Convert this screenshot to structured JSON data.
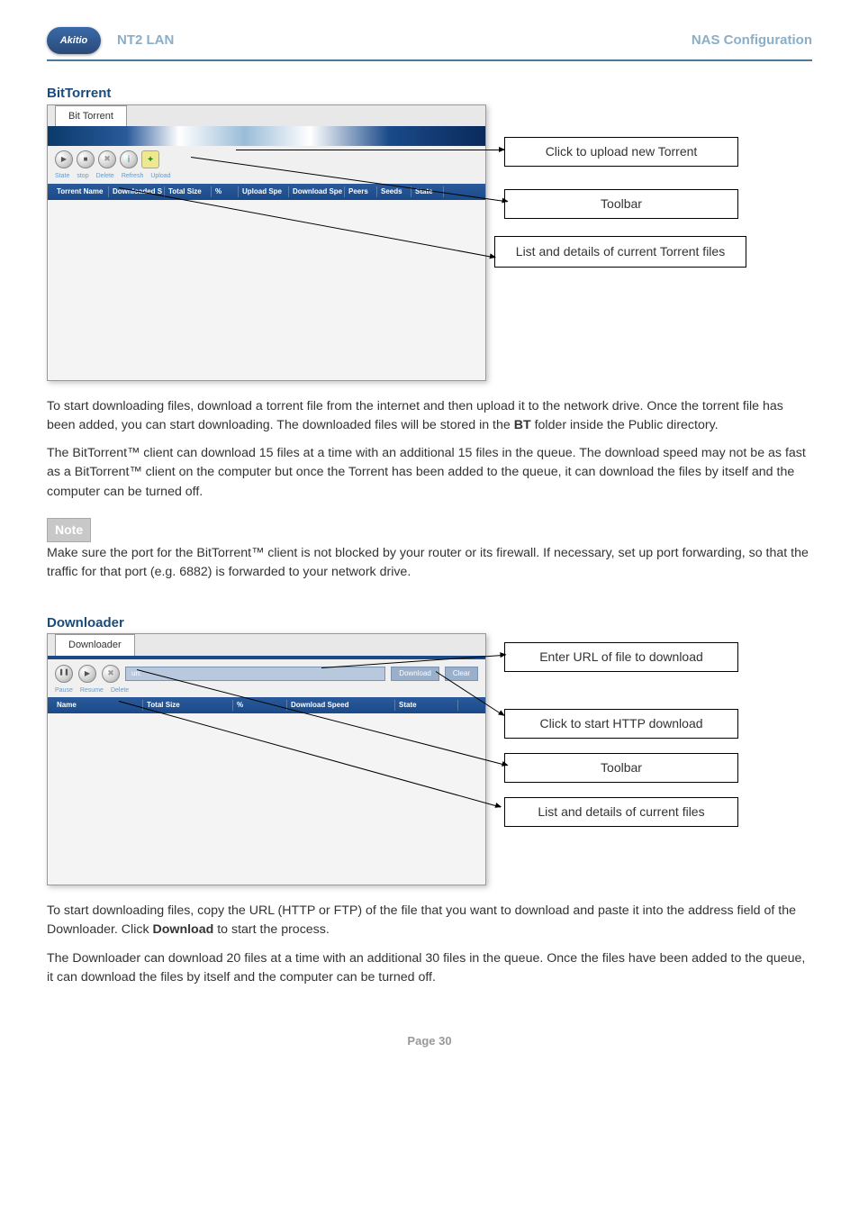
{
  "header": {
    "logo_text": "Akitio",
    "left": "NT2 LAN",
    "right": "NAS Configuration"
  },
  "bittorrent": {
    "section_title": "BitTorrent",
    "tab": "Bit Torrent",
    "sublabels": [
      "State",
      "stop",
      "Delete",
      "Refresh",
      "Upload"
    ],
    "cols": [
      "Torrent Name",
      "Downloaded S",
      "Total Size",
      "%",
      "Upload Spe",
      "Download Spe",
      "Peers",
      "Seeds",
      "State"
    ],
    "callouts": {
      "upload": "Click to upload new Torrent",
      "toolbar": "Toolbar",
      "list": "List and details of current Torrent files"
    },
    "para1_pre": "To start downloading files, download a torrent file from the internet and then upload it to the network drive. Once the torrent file has been added, you can start downloading. The downloaded files will be stored in the ",
    "para1_bold": "BT",
    "para1_post": " folder inside the Public directory.",
    "para2": "The BitTorrent™ client can download 15 files at a time with an additional 15 files in the queue. The download speed may not be as fast as a BitTorrent™ client on the computer but once the Torrent has been added to the queue, it can download the files by itself and the computer can be turned off.",
    "note_label": "Note",
    "note_text": "Make sure the port for the BitTorrent™ client is not blocked by your router or its firewall. If necessary, set up port forwarding, so that the traffic for that port (e.g. 6882) is forwarded to your network drive."
  },
  "downloader": {
    "section_title": "Downloader",
    "tab": "Downloader",
    "url_placeholder": "url:",
    "btn_download": "Download",
    "btn_clear": "Clear",
    "sublabels": [
      "Pause",
      "Resume",
      "Delete"
    ],
    "cols": [
      "Name",
      "Total Size",
      "%",
      "Download Speed",
      "State"
    ],
    "callouts": {
      "url": "Enter URL of file to download",
      "download": "Click to start HTTP download",
      "toolbar": "Toolbar",
      "list": "List and details of current files"
    },
    "para1_pre": "To start downloading files, copy the URL (HTTP or FTP) of the file that you want to download and paste it into the address field of the Downloader. Click ",
    "para1_bold": "Download",
    "para1_post": " to start the process.",
    "para2": "The Downloader can download 20 files at a time with an additional 30 files in the queue. Once the files have been added to the queue, it can download the files by itself and the computer can be turned off."
  },
  "footer": "Page 30"
}
